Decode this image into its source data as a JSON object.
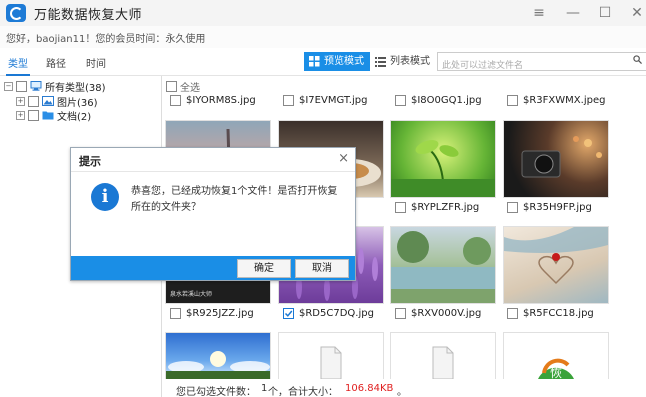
{
  "app": {
    "title": "万能数据恢复大师",
    "user_info": "您好，baojian11！您的会员时间：永久使用"
  },
  "window_controls": [
    "≡",
    "—",
    "☐",
    "✕"
  ],
  "left_tabs": [
    {
      "label": "类型",
      "active": true
    },
    {
      "label": "路径",
      "active": false
    },
    {
      "label": "时间",
      "active": false
    }
  ],
  "view_modes": {
    "preview": "预览模式",
    "list": "列表模式"
  },
  "search": {
    "placeholder": "此处可以过滤文件名"
  },
  "tree": {
    "root": "所有类型(38)",
    "children": [
      "图片(36)",
      "文档(2)"
    ]
  },
  "content": {
    "select_all": "全选",
    "files_row1": [
      "$IYORM8S.jpg",
      "$I7EVMGT.jpg",
      "$I8O0GQ1.jpg",
      "$R3FXWMX.jpeg"
    ],
    "files_row2": [
      "",
      "",
      "$RYPLZFR.jpg",
      "$R35H9FP.jpg"
    ],
    "files_row3": [
      "$R925JZZ.jpg",
      "$RD5C7DQ.jpg",
      "$RXV000V.jpg",
      "$R5FCC18.jpg"
    ],
    "thumb_caption": "泉水若溪山大师"
  },
  "status": {
    "prefix": "您已勾选文件数：",
    "count": "1",
    "middle": "个，合计大小：",
    "size": "106.84KB",
    "suffix": "。"
  },
  "dialog": {
    "title": "提示",
    "message": "恭喜您，已经成功恢复1个文件！是否打开恢复所在的文件夹？",
    "ok": "确定",
    "cancel": "取消"
  },
  "colors": {
    "accent": "#1a8ee6",
    "size_highlight": "#e02020"
  }
}
